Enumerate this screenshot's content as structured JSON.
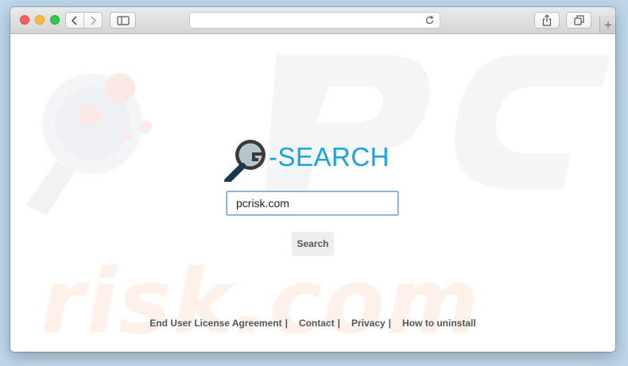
{
  "browser": {
    "address_value": "",
    "new_tab_glyph": "+"
  },
  "logo": {
    "text": "-SEARCH",
    "icon": "magnifier-icon",
    "color": "#1aa3dd"
  },
  "search": {
    "value": "pcrisk.com",
    "button_label": "Search"
  },
  "footer": {
    "links": [
      {
        "label": "End User License Agreement",
        "sep": "|"
      },
      {
        "label": "Contact",
        "sep": "|"
      },
      {
        "label": "Privacy",
        "sep": "|"
      },
      {
        "label": "How to uninstall",
        "sep": ""
      }
    ]
  },
  "watermark": {
    "text": "risk.com",
    "logo": "PC"
  }
}
